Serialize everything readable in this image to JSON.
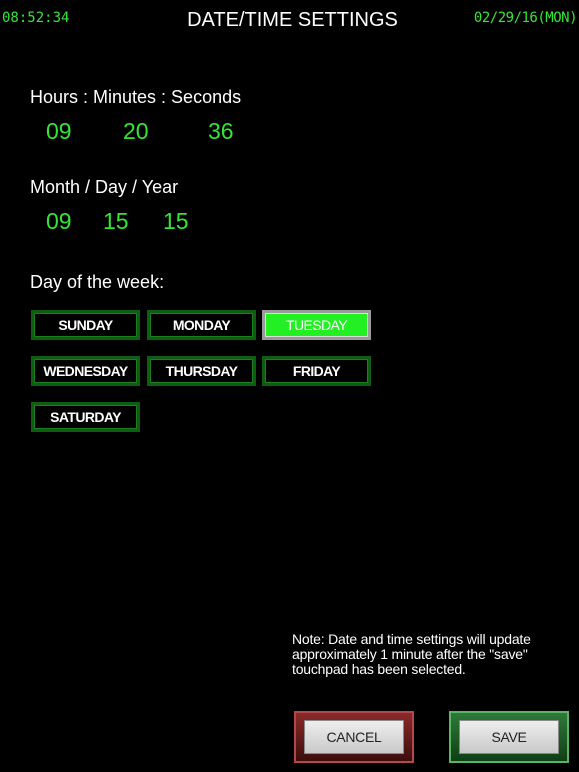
{
  "status_bar": {
    "clock": "08:52:34",
    "date": "02/29/16(MON)"
  },
  "title": "DATE/TIME SETTINGS",
  "time_section": {
    "label": "Hours : Minutes : Seconds",
    "hours": "09",
    "minutes": "20",
    "seconds": "36"
  },
  "date_section": {
    "label": "Month / Day / Year",
    "month": "09",
    "day": "15",
    "year": "15"
  },
  "weekday_section": {
    "label": "Day of the week:",
    "days": [
      "SUNDAY",
      "MONDAY",
      "TUESDAY",
      "WEDNESDAY",
      "THURSDAY",
      "FRIDAY",
      "SATURDAY"
    ],
    "selected": "TUESDAY"
  },
  "note": "Note: Date and time settings will update approximately 1 minute after the \"save\" touchpad has been selected.",
  "actions": {
    "cancel_label": "CANCEL",
    "save_label": "SAVE"
  },
  "colors": {
    "accent_green": "#35e535",
    "selected_day": "#22f022",
    "button_border": "#0f5d12",
    "cancel_frame": "#8a2a2a",
    "save_frame": "#2f7a38"
  }
}
